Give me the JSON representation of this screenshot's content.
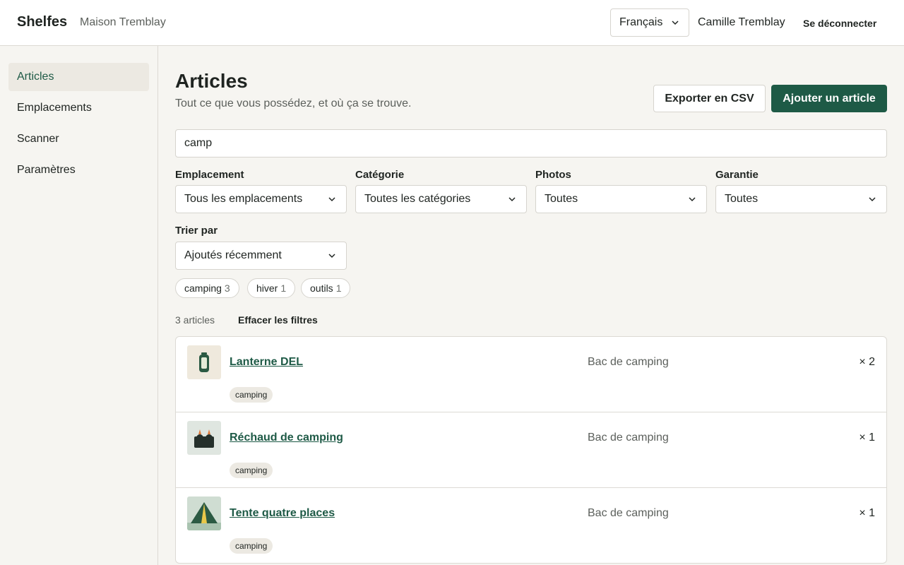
{
  "header": {
    "brand": "Shelfes",
    "household": "Maison Tremblay",
    "language": "Français",
    "user": "Camille Tremblay",
    "logout": "Se déconnecter"
  },
  "sidebar": {
    "items": [
      {
        "label": "Articles",
        "active": true
      },
      {
        "label": "Emplacements",
        "active": false
      },
      {
        "label": "Scanner",
        "active": false
      },
      {
        "label": "Paramètres",
        "active": false
      }
    ]
  },
  "page": {
    "title": "Articles",
    "subtitle": "Tout ce que vous possédez, et où ça se trouve.",
    "export_label": "Exporter en CSV",
    "add_label": "Ajouter un article"
  },
  "search": {
    "value": "camp"
  },
  "filters": {
    "location": {
      "label": "Emplacement",
      "value": "Tous les emplacements"
    },
    "category": {
      "label": "Catégorie",
      "value": "Toutes les catégories"
    },
    "photos": {
      "label": "Photos",
      "value": "Toutes"
    },
    "warranty": {
      "label": "Garantie",
      "value": "Toutes"
    },
    "sort": {
      "label": "Trier par",
      "value": "Ajoutés récemment"
    }
  },
  "tag_chips": [
    {
      "name": "camping",
      "count": "3"
    },
    {
      "name": "hiver",
      "count": "1"
    },
    {
      "name": "outils",
      "count": "1"
    }
  ],
  "results": {
    "count_text": "3 articles",
    "clear_label": "Effacer les filtres"
  },
  "items": [
    {
      "name": "Lanterne DEL",
      "location": "Bac de camping",
      "quantity": "× 2",
      "tag": "camping",
      "icon": "lantern-icon"
    },
    {
      "name": "Réchaud de camping",
      "location": "Bac de camping",
      "quantity": "× 1",
      "tag": "camping",
      "icon": "camp-stove-icon"
    },
    {
      "name": "Tente quatre places",
      "location": "Bac de camping",
      "quantity": "× 1",
      "tag": "camping",
      "icon": "tent-icon"
    }
  ],
  "colors": {
    "accent": "#1e5a46",
    "background": "#f6f5f1",
    "border": "#dcdad4"
  }
}
